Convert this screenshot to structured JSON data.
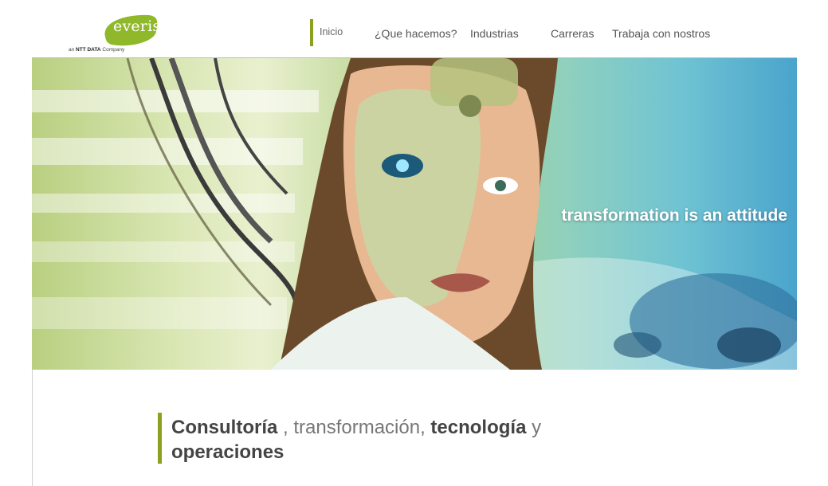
{
  "logo": {
    "brand": "everis",
    "tagline_prefix": "an ",
    "tagline_brand": "NTT DATA",
    "tagline_suffix": " Company"
  },
  "nav": {
    "items": [
      {
        "label": "Inicio",
        "active": true
      },
      {
        "label": "¿Que hacemos?"
      },
      {
        "label": "Industrias"
      },
      {
        "label": "Carreras"
      },
      {
        "label": "Trabaja con nostros"
      }
    ]
  },
  "hero": {
    "caption": "transformation is an attitude"
  },
  "headline": {
    "w1": "Consultoría",
    "s1": " , transformación, ",
    "w2": "tecnología",
    "s2": " y",
    "w3": "operaciones"
  },
  "colors": {
    "accent": "#8aa21f",
    "logo_green": "#8fb82a"
  }
}
